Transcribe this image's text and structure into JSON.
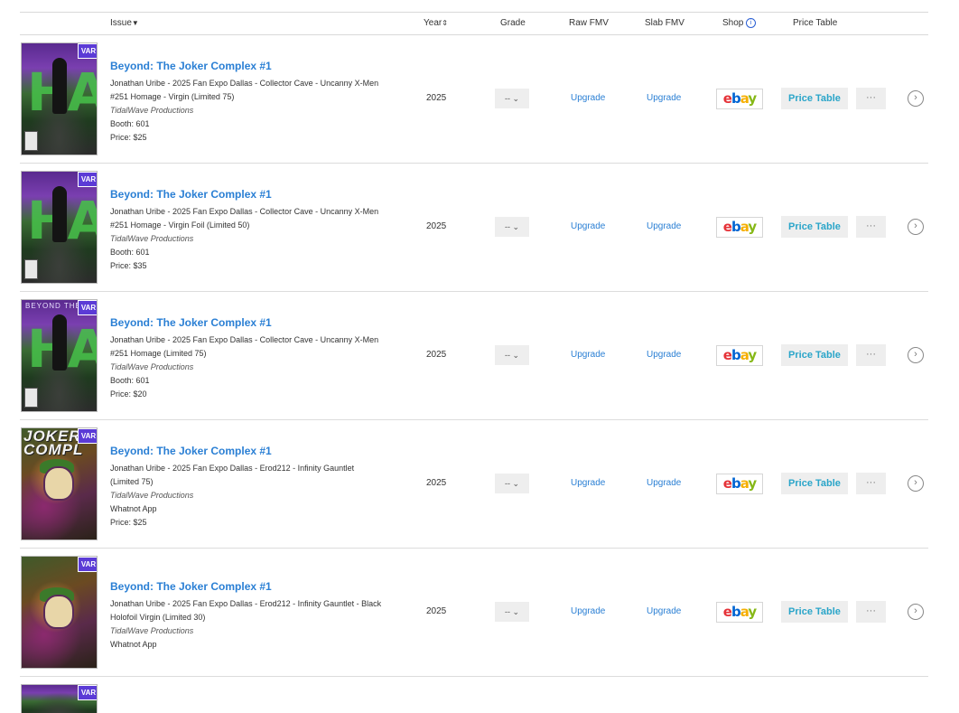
{
  "header": {
    "issue": "Issue",
    "year": "Year",
    "grade": "Grade",
    "raw_fmv": "Raw FMV",
    "slab_fmv": "Slab FMV",
    "shop": "Shop",
    "price_table": "Price Table",
    "sort_issue_icon": "caret-down-icon",
    "sort_year_icon": "sort-updown-icon",
    "shop_info_icon": "info-icon"
  },
  "common": {
    "badge": "VAR",
    "grade_value": "-- ⌄",
    "upgrade": "Upgrade",
    "price_table_btn": "Price Table",
    "more_btn": "···",
    "go_icon": "›",
    "ebay_e": "e",
    "ebay_b": "b",
    "ebay_a": "a",
    "ebay_y": "y"
  },
  "colors": {
    "link": "#2a7fd4",
    "badge": "#5b3bd6",
    "price_table_text": "#2aa5c9"
  },
  "rows": [
    {
      "title": "Beyond: The Joker Complex #1",
      "desc1": "Jonathan Uribe - 2025 Fan Expo Dallas - Collector Cave - Uncanny X-Men",
      "desc2": "#251 Homage - Virgin (Limited 75)",
      "publisher": "TidalWave Productions",
      "line1": "Booth: 601",
      "line2": "Price: $25",
      "year": "2025"
    },
    {
      "title": "Beyond: The Joker Complex #1",
      "desc1": "Jonathan Uribe - 2025 Fan Expo Dallas - Collector Cave - Uncanny X-Men",
      "desc2": "#251 Homage - Virgin Foil (Limited 50)",
      "publisher": "TidalWave Productions",
      "line1": "Booth: 601",
      "line2": "Price: $35",
      "year": "2025"
    },
    {
      "title": "Beyond: The Joker Complex #1",
      "desc1": "Jonathan Uribe - 2025 Fan Expo Dallas - Collector Cave - Uncanny X-Men",
      "desc2": "#251 Homage (Limited 75)",
      "publisher": "TidalWave Productions",
      "line1": "Booth: 601",
      "line2": "Price: $20",
      "year": "2025",
      "cover_text": "BEYOND THE"
    },
    {
      "title": "Beyond: The Joker Complex #1",
      "desc1": "Jonathan Uribe - 2025 Fan Expo Dallas - Erod212 - Infinity Gauntlet",
      "desc2": "(Limited 75)",
      "publisher": "TidalWave Productions",
      "line1": "Whatnot App",
      "line2": "Price: $25",
      "year": "2025",
      "cover_text": "JOKER COMPL"
    },
    {
      "title": "Beyond: The Joker Complex #1",
      "desc1": "Jonathan Uribe - 2025 Fan Expo Dallas - Erod212 - Infinity Gauntlet - Black",
      "desc2": "Holofoil Virgin (Limited 30)",
      "publisher": "TidalWave Productions",
      "line1": "Whatnot App",
      "year": "2025"
    }
  ]
}
